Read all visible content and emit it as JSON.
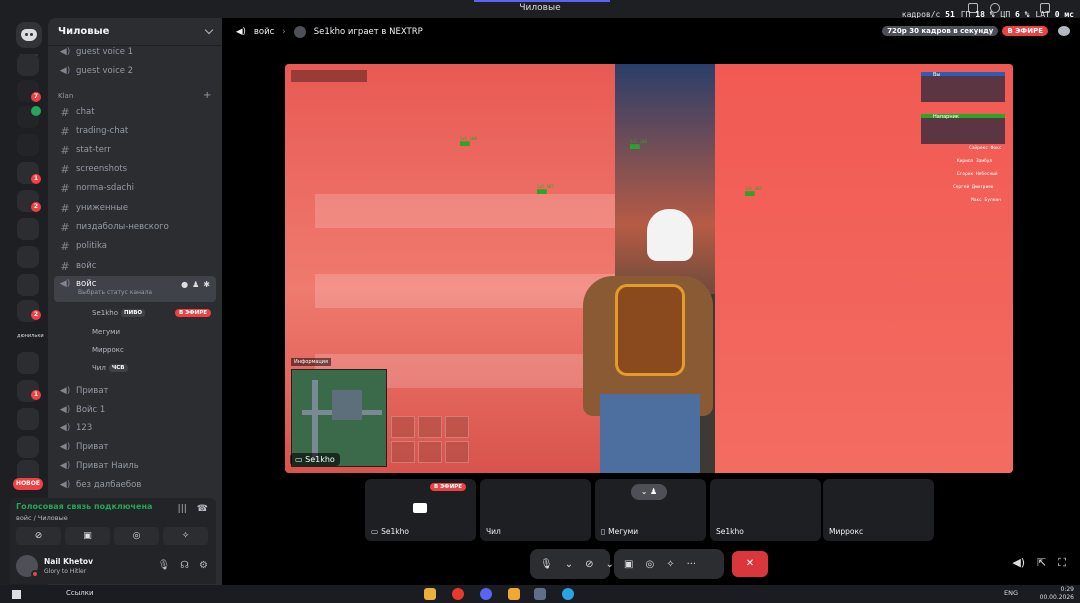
{
  "window": {
    "title": "Чиловые"
  },
  "perf": {
    "fps_label": "кадров/с",
    "fps": "51",
    "gpu_label": "ГП",
    "gpu": "18 %",
    "cpu_label": "ЦП",
    "cpu": "6 %",
    "lat_label": "LAT",
    "lat": "0 мс"
  },
  "server": {
    "name": "Чиловые"
  },
  "channels": {
    "voice_top": [
      "guest voice 1",
      "guest voice 2"
    ],
    "category": "Klan",
    "text": [
      "chat",
      "trading-chat",
      "stat-terr",
      "screenshots",
      "norma-sdachi",
      "униженные",
      "пиздаболы-невского",
      "politika"
    ],
    "voice_mid": "войс",
    "active": {
      "name": "войс",
      "status_hint": "Выбрать статус канала"
    },
    "voice_users": [
      {
        "name": "Se1kho",
        "tag": "ПИВО",
        "live": "В ЭФИРЕ"
      },
      {
        "name": "Мегуми"
      },
      {
        "name": "Миррокс"
      },
      {
        "name": "Чил",
        "tag": "ЧСВ"
      }
    ],
    "voice_bottom": [
      "Приват",
      "Войс 1",
      "123",
      "Приват",
      "Приват Наиль",
      "без далбаебов"
    ]
  },
  "rail": {
    "server_label": "дюнильки",
    "new_label": "НОВОЕ",
    "badges": [
      "7",
      "1",
      "2",
      "2",
      "1"
    ]
  },
  "voice_panel": {
    "status": "Голосовая связь подключена",
    "channel": "войс / Чиловые"
  },
  "user": {
    "name": "Nail Khetov",
    "status": "Glory to Hitler"
  },
  "stream": {
    "channel": "войс",
    "title": "Se1kho играет в NEXTRP",
    "quality": "720p 30 кадров в секунду",
    "live": "В ЭФИРЕ",
    "streamer": "Se1kho",
    "minimap_label": "Информация",
    "hud_players": [
      "Вы",
      "Напарник"
    ],
    "right_list": [
      "Сайрекс Фокс",
      "Кирилл Замбул",
      "Егорик Небесный",
      "Сергей Дмитриев",
      "Макс Булкин"
    ]
  },
  "participants": [
    {
      "name": "Se1kho",
      "live": "В ЭФИРЕ"
    },
    {
      "name": "Чил"
    },
    {
      "name": "Мегуми"
    },
    {
      "name": "Se1kho"
    },
    {
      "name": "Миррокс"
    }
  ],
  "taskbar": {
    "search": "Ссылки",
    "lang": "ENG",
    "time": "0:29",
    "date": "00.00.2026"
  }
}
